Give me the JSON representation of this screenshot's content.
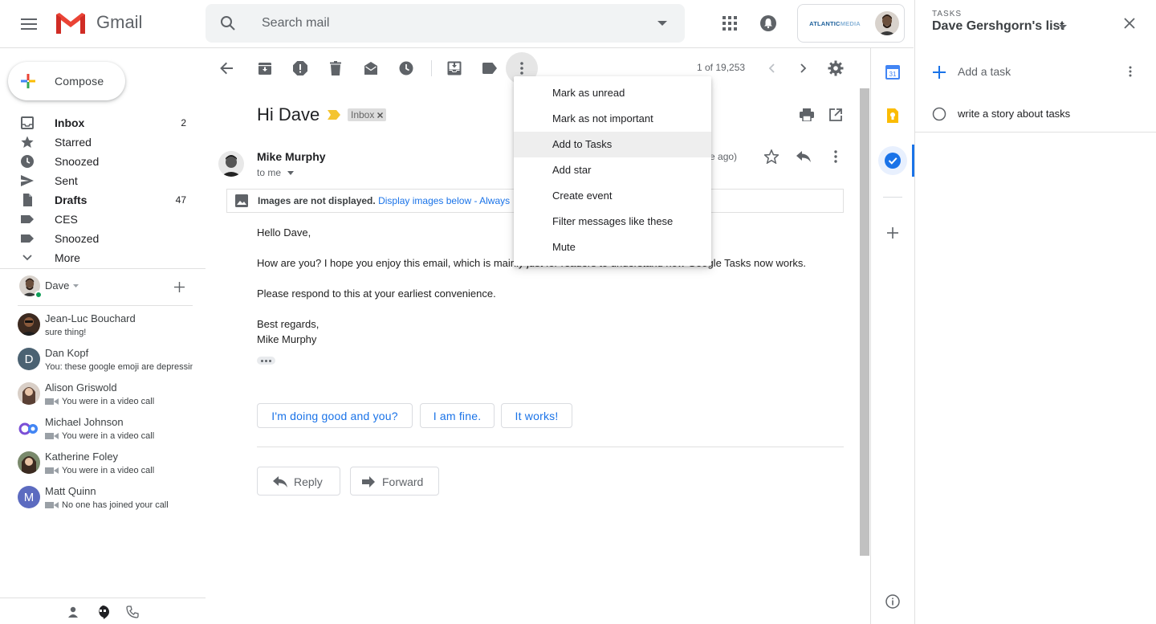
{
  "header": {
    "brand": "Gmail",
    "search_placeholder": "Search mail",
    "org_logo_primary": "ATLANTIC",
    "org_logo_secondary": "MEDIA"
  },
  "sidebar": {
    "compose_label": "Compose",
    "nav": [
      {
        "label": "Inbox",
        "count": "2",
        "bold": true,
        "icon": "inbox-icon"
      },
      {
        "label": "Starred",
        "count": "",
        "bold": false,
        "icon": "star-icon"
      },
      {
        "label": "Snoozed",
        "count": "",
        "bold": false,
        "icon": "clock-icon"
      },
      {
        "label": "Sent",
        "count": "",
        "bold": false,
        "icon": "send-icon"
      },
      {
        "label": "Drafts",
        "count": "47",
        "bold": true,
        "icon": "draft-icon"
      },
      {
        "label": "CES",
        "count": "",
        "bold": false,
        "icon": "label-icon"
      },
      {
        "label": "Snoozed",
        "count": "",
        "bold": false,
        "icon": "label-icon"
      },
      {
        "label": "More",
        "count": "",
        "bold": false,
        "icon": "chevron-down-icon"
      }
    ],
    "chat_user": "Dave",
    "chats": [
      {
        "name": "Jean-Luc Bouchard",
        "sub": "sure thing!",
        "video": false,
        "initial": "",
        "avatar_color": "#3c2a20"
      },
      {
        "name": "Dan Kopf",
        "sub": "You: these google emoji are depressing",
        "video": false,
        "initial": "D",
        "avatar_color": "#4b6272"
      },
      {
        "name": "Alison Griswold",
        "sub": "You were in a video call",
        "video": true,
        "initial": "",
        "avatar_color": "#b9a69a"
      },
      {
        "name": "Michael Johnson",
        "sub": "You were in a video call",
        "video": true,
        "initial": "",
        "avatar_color": "#ffffff"
      },
      {
        "name": "Katherine Foley",
        "sub": "You were in a video call",
        "video": true,
        "initial": "",
        "avatar_color": "#7a8a6c"
      },
      {
        "name": "Matt Quinn",
        "sub": "No one has joined your call",
        "video": true,
        "initial": "M",
        "avatar_color": "#5c6bc0"
      }
    ]
  },
  "toolbar": {
    "page_count": "1 of 19,253"
  },
  "message": {
    "subject": "Hi Dave",
    "label_tag": "Inbox",
    "sender": "Mike Murphy",
    "to": "to me",
    "time_ago": "ute ago)",
    "images_notice_bold": "Images are not displayed.",
    "images_notice_link": "Display images below - Always",
    "greeting": "Hello Dave,",
    "body_line_1": "How are you? I hope you enjoy this email, which is mainly just for readers to understand how Google Tasks now works.",
    "body_line_2": "Please respond to this at your earliest convenience.",
    "signoff": "Best regards,",
    "signature": "Mike Murphy"
  },
  "smart_replies": [
    "I'm doing good and you?",
    "I am fine.",
    "It works!"
  ],
  "actions": {
    "reply": "Reply",
    "forward": "Forward"
  },
  "menu": {
    "items": [
      "Mark as unread",
      "Mark as not important",
      "Add to Tasks",
      "Add star",
      "Create event",
      "Filter messages like these",
      "Mute"
    ],
    "highlighted_index": 2
  },
  "side_rail": {
    "calendar_day": "31"
  },
  "tasks": {
    "app_label": "TASKS",
    "list_name": "Dave Gershgorn's list",
    "add_task_label": "Add a task",
    "items": [
      "write a story about tasks"
    ]
  },
  "colors": {
    "accent_blue": "#1a73e8",
    "gmail_red": "#ea4335",
    "online_green": "#0f9d58"
  }
}
